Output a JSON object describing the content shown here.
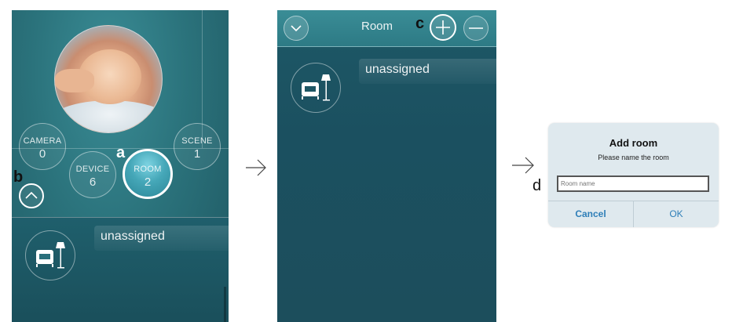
{
  "screen1": {
    "buttons": {
      "camera": {
        "label": "CAMERA",
        "count": "0"
      },
      "device": {
        "label": "DEVICE",
        "count": "6"
      },
      "room": {
        "label": "ROOM",
        "count": "2"
      },
      "scene": {
        "label": "SCENE",
        "count": "1"
      }
    },
    "room_item": {
      "label": "unassigned"
    }
  },
  "screen2": {
    "title": "Room",
    "room_item": {
      "label": "unassigned"
    }
  },
  "dialog": {
    "title": "Add room",
    "subtitle": "Please name the room",
    "input_placeholder": "Room name",
    "cancel_label": "Cancel",
    "ok_label": "OK"
  },
  "callouts": {
    "a": "a",
    "b": "b",
    "c": "c",
    "d": "d"
  },
  "arrows": {
    "symbol": "→"
  },
  "icons": [
    "chevron-up-icon",
    "chevron-down-icon",
    "plus-icon",
    "minus-icon",
    "armchair-lamp-icon"
  ],
  "colors": {
    "teal_dark": "#1c4e5c",
    "teal_light": "#3a8d96",
    "dialog_bg": "#dfe9ee",
    "dialog_button": "#2f7fb8"
  }
}
